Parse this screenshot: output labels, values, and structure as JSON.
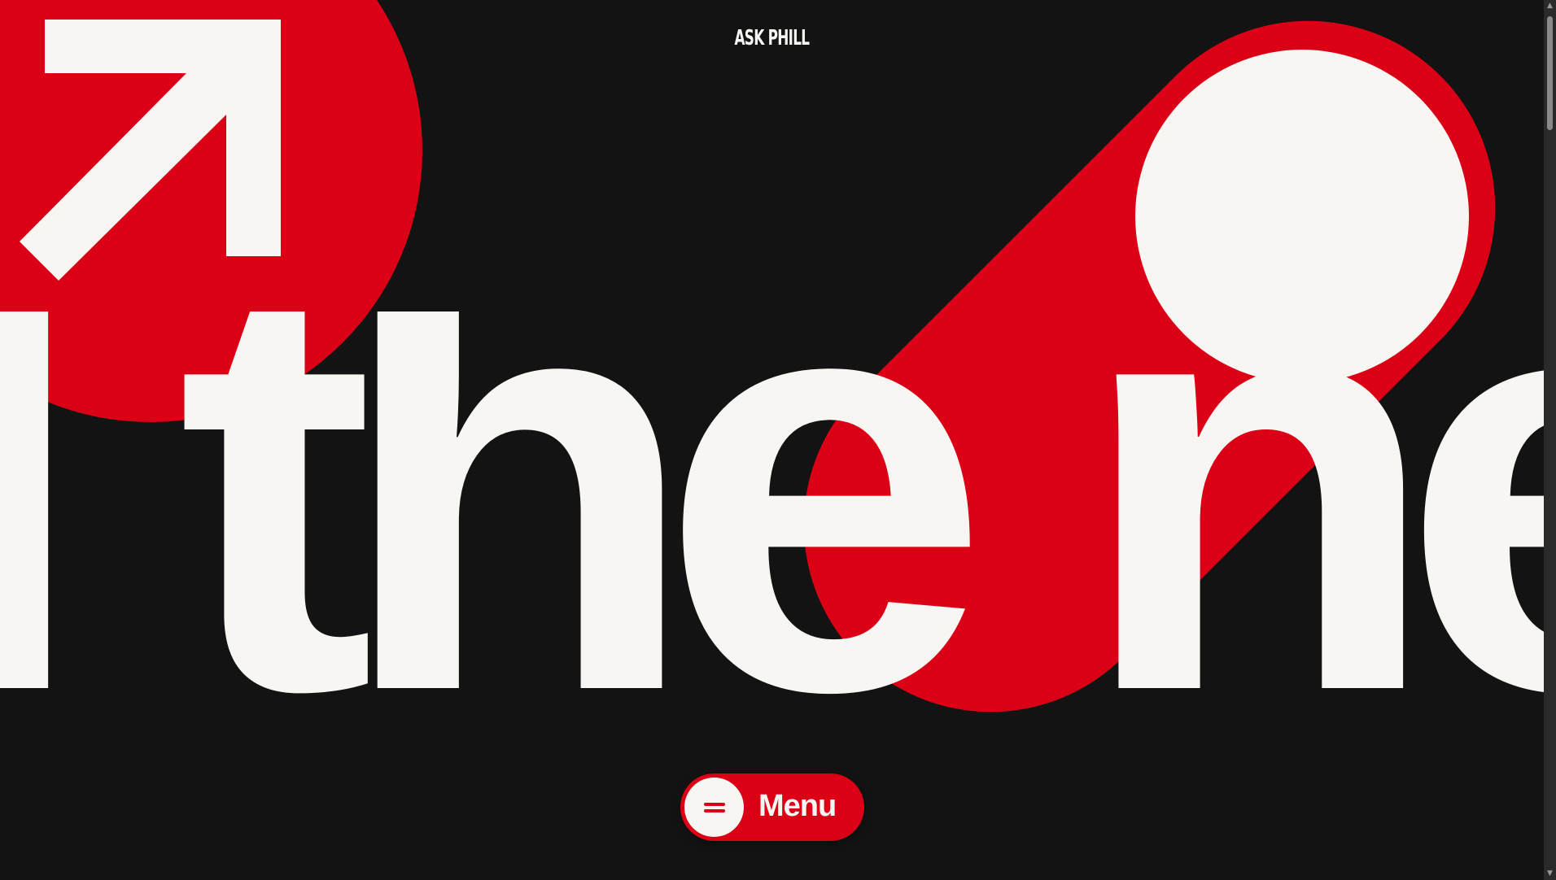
{
  "header": {
    "brand": "ASK PHILL"
  },
  "hero": {
    "headline": "l the ne"
  },
  "menu": {
    "label": "Menu",
    "icon": "hamburger-icon"
  },
  "colors": {
    "background": "#131313",
    "accent": "#dc0016",
    "foreground": "#f7f6f2"
  },
  "scrollbar": {
    "up_arrow": "▲",
    "down_arrow": "▼"
  }
}
